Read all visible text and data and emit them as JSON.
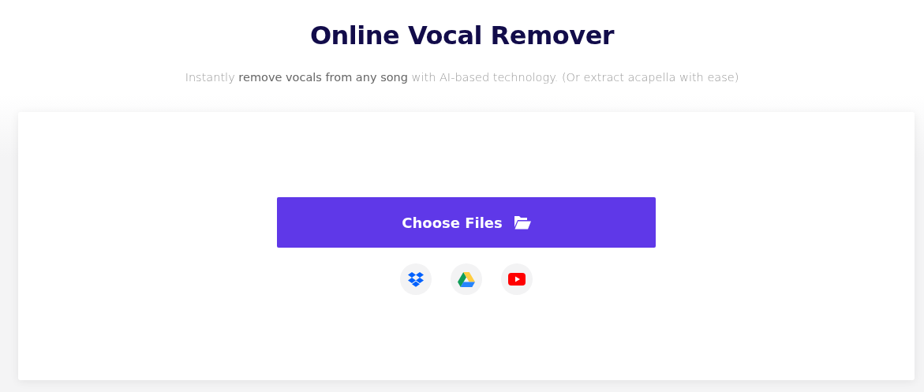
{
  "title": "Online Vocal Remover",
  "subtitle": "Instantly **remove vocals from any song** with AI-based technology. (Or extract acapella with ease)",
  "upload": {
    "button_label": "Choose Files",
    "sources": [
      {
        "kind": "dropbox"
      },
      {
        "kind": "drive"
      },
      {
        "kind": "youtube"
      }
    ]
  }
}
